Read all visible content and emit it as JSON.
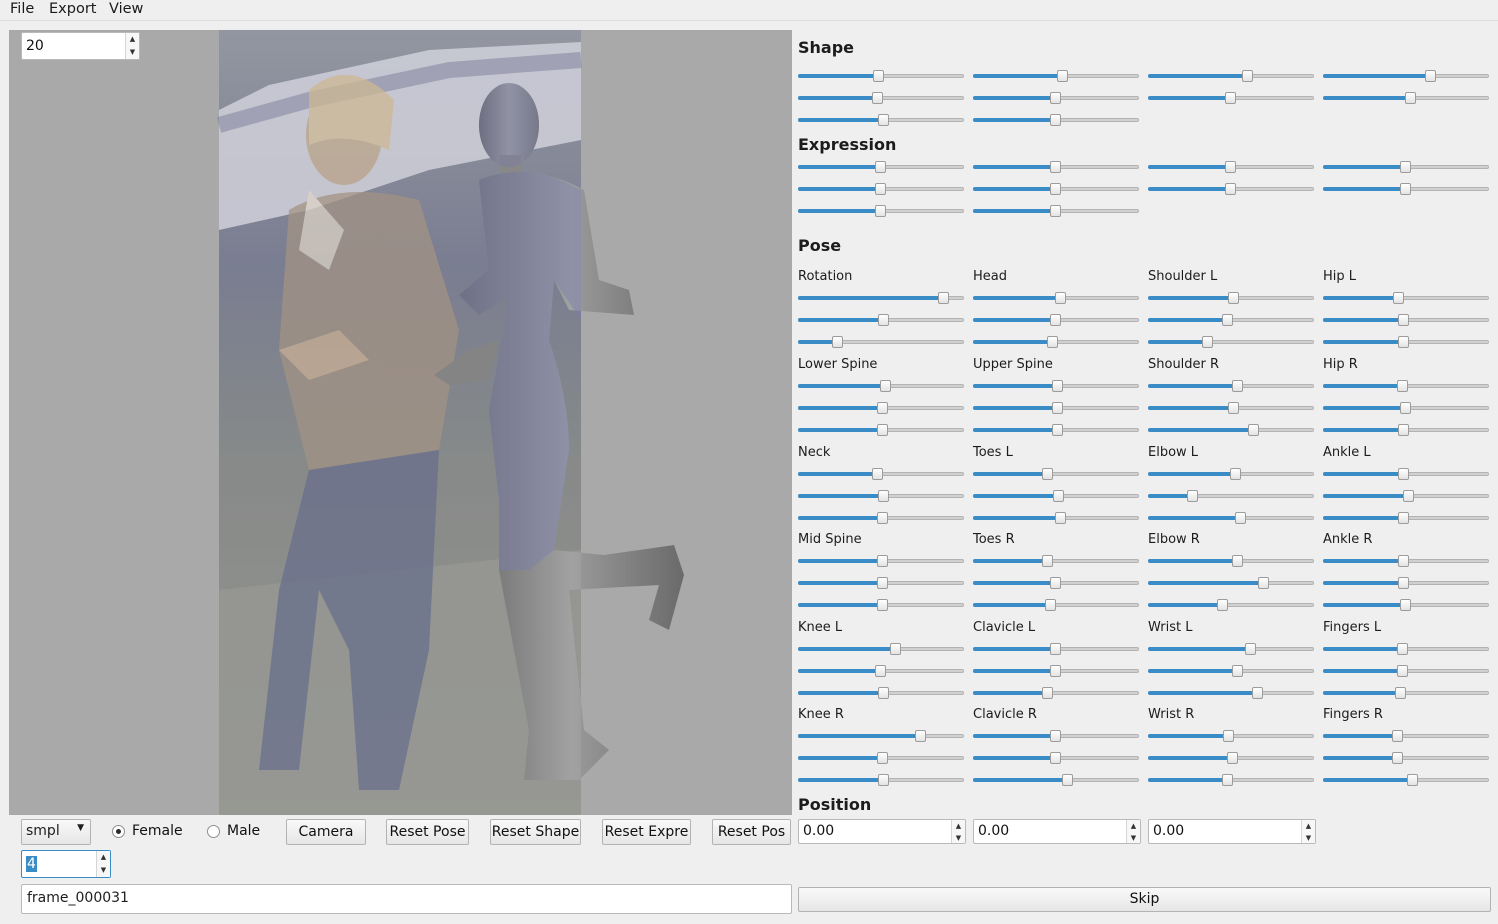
{
  "menu": [
    "File",
    "Export",
    "View"
  ],
  "viewport": {
    "frame_spin_value": "20"
  },
  "sections": {
    "shape": "Shape",
    "expression": "Expression",
    "pose": "Pose",
    "position": "Position"
  },
  "shape_sliders": [
    0.49,
    0.54,
    0.6,
    0.65,
    0.48,
    0.5,
    0.5,
    0.53,
    0.52,
    0.5
  ],
  "expression_sliders": [
    0.5,
    0.5,
    0.5,
    0.5,
    0.5,
    0.5,
    0.5,
    0.5,
    0.5,
    0.5
  ],
  "pose_groups": [
    {
      "label": "Rotation",
      "values": [
        0.88,
        0.52,
        0.24
      ]
    },
    {
      "label": "Head",
      "values": [
        0.53,
        0.5,
        0.48
      ]
    },
    {
      "label": "Shoulder L",
      "values": [
        0.52,
        0.48,
        0.36
      ]
    },
    {
      "label": "Hip L",
      "values": [
        0.46,
        0.49,
        0.49
      ]
    },
    {
      "label": "Lower Spine",
      "values": [
        0.53,
        0.51,
        0.51
      ]
    },
    {
      "label": "Upper Spine",
      "values": [
        0.51,
        0.51,
        0.51
      ]
    },
    {
      "label": "Shoulder R",
      "values": [
        0.54,
        0.52,
        0.64
      ]
    },
    {
      "label": "Hip R",
      "values": [
        0.48,
        0.5,
        0.49
      ]
    },
    {
      "label": "Neck",
      "values": [
        0.48,
        0.52,
        0.51
      ]
    },
    {
      "label": "Toes L",
      "values": [
        0.45,
        0.52,
        0.53
      ]
    },
    {
      "label": "Elbow L",
      "values": [
        0.53,
        0.27,
        0.56
      ]
    },
    {
      "label": "Ankle L",
      "values": [
        0.49,
        0.52,
        0.49
      ]
    },
    {
      "label": "Mid Spine",
      "values": [
        0.51,
        0.51,
        0.51
      ]
    },
    {
      "label": "Toes R",
      "values": [
        0.45,
        0.5,
        0.47
      ]
    },
    {
      "label": "Elbow R",
      "values": [
        0.54,
        0.7,
        0.45
      ]
    },
    {
      "label": "Ankle R",
      "values": [
        0.49,
        0.49,
        0.5
      ]
    },
    {
      "label": "Knee L",
      "values": [
        0.59,
        0.5,
        0.52
      ]
    },
    {
      "label": "Clavicle L",
      "values": [
        0.5,
        0.5,
        0.45
      ]
    },
    {
      "label": "Wrist L",
      "values": [
        0.62,
        0.54,
        0.66
      ]
    },
    {
      "label": "Fingers L",
      "values": [
        0.48,
        0.48,
        0.47
      ]
    },
    {
      "label": "Knee R",
      "values": [
        0.74,
        0.51,
        0.52
      ]
    },
    {
      "label": "Clavicle R",
      "values": [
        0.5,
        0.5,
        0.57
      ]
    },
    {
      "label": "Wrist R",
      "values": [
        0.49,
        0.51,
        0.48
      ]
    },
    {
      "label": "Fingers R",
      "values": [
        0.45,
        0.45,
        0.54
      ]
    }
  ],
  "bottom": {
    "model_select": "smpl",
    "gender_female": "Female",
    "gender_male": "Male",
    "gender_selected": "female",
    "camera": "Camera",
    "reset_pose": "Reset Pose",
    "reset_shape": "Reset Shape",
    "reset_expr": "Reset Expre",
    "reset_pos": "Reset Pos",
    "index_spin": "4",
    "frame_name": "frame_000031",
    "skip": "Skip"
  },
  "position": [
    "0.00",
    "0.00",
    "0.00"
  ],
  "colors": {
    "accent": "#3a8cc7",
    "viewport_bg": "#a9a9a9",
    "mesh_overlay": "#6f73a6"
  }
}
